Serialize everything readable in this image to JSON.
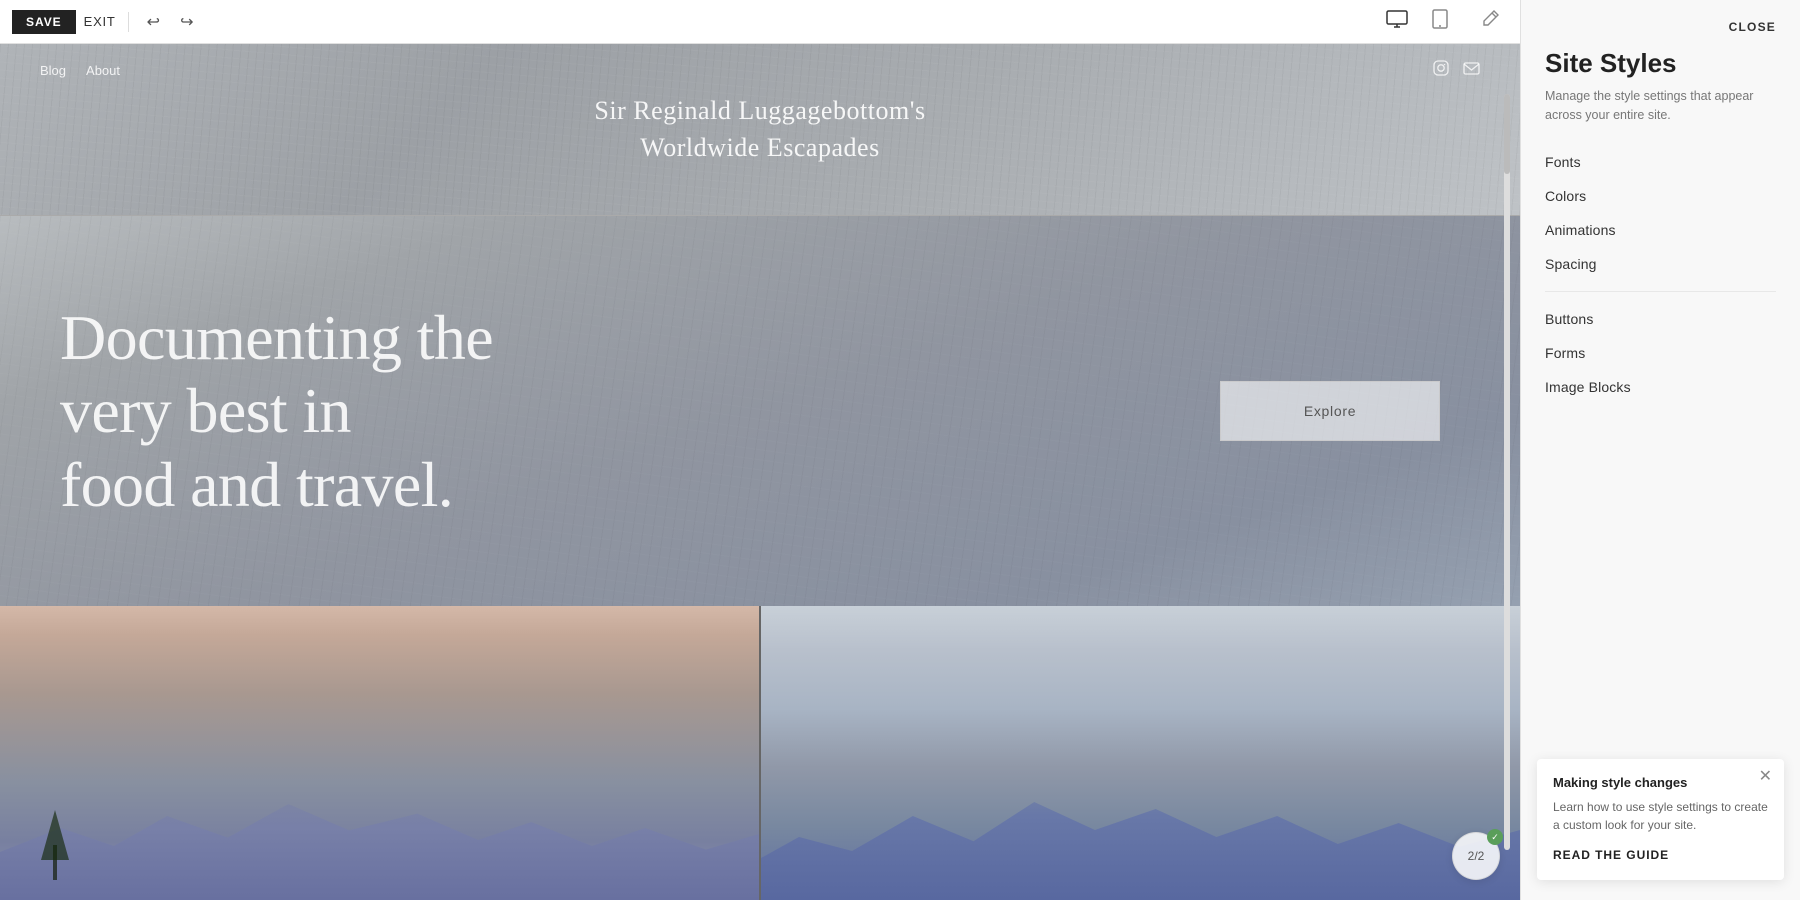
{
  "toolbar": {
    "save_label": "SAVE",
    "exit_label": "EXIT",
    "undo_icon": "↩",
    "redo_icon": "↪"
  },
  "site": {
    "title_line1": "Sir Reginald Luggagebottom's",
    "title_line2": "Worldwide Escapades",
    "nav_links": [
      "Blog",
      "About"
    ],
    "hero_heading_line1": "Documenting the very best in",
    "hero_heading_line2": "food and travel.",
    "explore_button": "Explore"
  },
  "page_counter": {
    "label": "2/2"
  },
  "panel": {
    "close_label": "CLOSE",
    "title": "Site Styles",
    "subtitle": "Manage the style settings that appear across your entire site.",
    "nav_items": [
      {
        "id": "fonts",
        "label": "Fonts"
      },
      {
        "id": "colors",
        "label": "Colors"
      },
      {
        "id": "animations",
        "label": "Animations"
      },
      {
        "id": "spacing",
        "label": "Spacing"
      }
    ],
    "nav_items_2": [
      {
        "id": "buttons",
        "label": "Buttons"
      },
      {
        "id": "forms",
        "label": "Forms"
      },
      {
        "id": "image-blocks",
        "label": "Image Blocks"
      }
    ]
  },
  "tooltip": {
    "title": "Making style changes",
    "text": "Learn how to use style settings to create a custom look for your site.",
    "link_label": "READ THE GUIDE"
  }
}
